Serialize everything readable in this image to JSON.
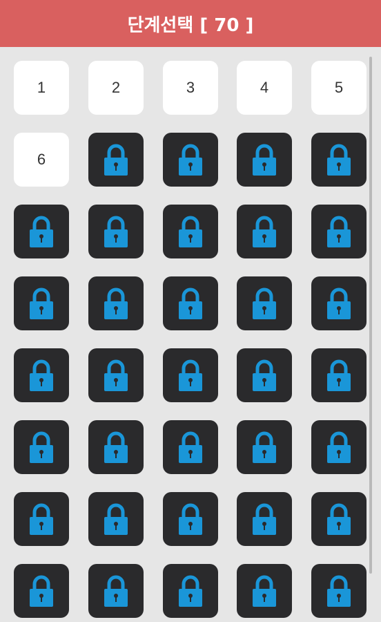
{
  "header": {
    "title": "단계선택 [ 70 ]"
  },
  "levels": {
    "open": [
      "1",
      "2",
      "3",
      "4",
      "5",
      "6"
    ],
    "locked_icon": "lock-icon",
    "columns": 5,
    "visible_rows": 8,
    "lock_color": "#1a96d8",
    "locked_tile_color": "#2a2a2c",
    "open_tile_color": "#ffffff"
  },
  "colors": {
    "header_bg": "#d9605f",
    "page_bg": "#e6e6e6"
  }
}
